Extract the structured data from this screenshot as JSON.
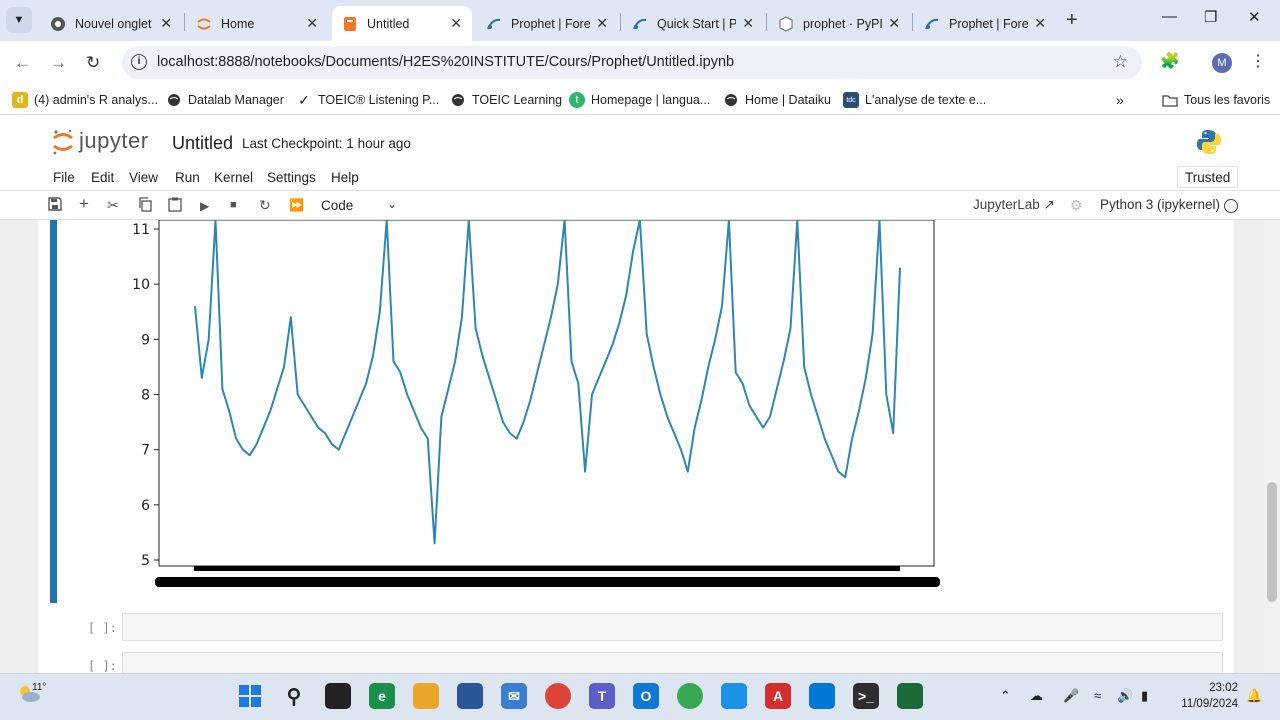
{
  "browser": {
    "tabs": [
      {
        "label": "Nouvel onglet",
        "icon": "chrome-icon"
      },
      {
        "label": "Home",
        "icon": "jupyter-icon"
      },
      {
        "label": "Untitled",
        "icon": "notebook-icon",
        "active": true
      },
      {
        "label": "Prophet | Fore",
        "icon": "prophet-icon"
      },
      {
        "label": "Quick Start | P",
        "icon": "prophet-icon"
      },
      {
        "label": "prophet · PyPI",
        "icon": "pypi-icon"
      },
      {
        "label": "Prophet | Fore",
        "icon": "prophet-icon"
      }
    ],
    "url": "localhost:8888/notebooks/Documents/H2ES%20INSTITUTE/Cours/Prophet/Untitled.ipynb",
    "profile_initial": "M",
    "bookmarks": [
      {
        "label": "(4) admin's R analys...",
        "icon": "d-icon",
        "icon_text": "d"
      },
      {
        "label": "Datalab Manager",
        "icon": "globe-icon"
      },
      {
        "label": "TOEIC® Listening P...",
        "icon": "check-icon"
      },
      {
        "label": "TOEIC Learning",
        "icon": "globe-icon"
      },
      {
        "label": "Homepage | langua...",
        "icon": "t-icon",
        "icon_text": "t"
      },
      {
        "label": "Home | Dataiku",
        "icon": "globe-icon"
      },
      {
        "label": "L'analyse de texte e...",
        "icon": "tdc-icon",
        "icon_text": "tdc"
      }
    ],
    "all_bookmarks": "Tous les favoris"
  },
  "jupyter": {
    "logo_text": "jupyter",
    "notebook_title": "Untitled",
    "checkpoint": "Last Checkpoint: 1 hour ago",
    "menu": [
      "File",
      "Edit",
      "View",
      "Run",
      "Kernel",
      "Settings",
      "Help"
    ],
    "trusted": "Trusted",
    "cell_type": "Code",
    "jupyterlab_link": "JupyterLab",
    "kernel": "Python 3 (ipykernel)",
    "empty_prompts": [
      "[ ]:",
      "[ ]:"
    ]
  },
  "chart_data": {
    "type": "line",
    "title": "",
    "xlabel": "",
    "ylabel": "",
    "yticks": [
      5,
      6,
      7,
      8,
      9,
      10,
      11
    ],
    "ylim": [
      4.9,
      11.3
    ],
    "line_color": "#2e86b5",
    "grid": false,
    "approx_cycles": 7,
    "series": [
      {
        "values": [
          9.6,
          8.3,
          9.0,
          11.2,
          8.1,
          7.7,
          7.2,
          7.0,
          6.9,
          7.1,
          7.4,
          7.7,
          8.1,
          8.5,
          9.4,
          8.0,
          7.8,
          7.6,
          7.4,
          7.3,
          7.1,
          7.0,
          7.3,
          7.6,
          7.9,
          8.2,
          8.7,
          9.5,
          11.2,
          8.6,
          8.4,
          8.0,
          7.7,
          7.4,
          7.2,
          5.3,
          7.6,
          8.1,
          8.6,
          9.4,
          11.2,
          9.2,
          8.7,
          8.3,
          7.9,
          7.5,
          7.3,
          7.2,
          7.5,
          7.9,
          8.4,
          8.9,
          9.4,
          10.0,
          11.2,
          8.6,
          8.2,
          6.6,
          8.0,
          8.3,
          8.6,
          8.9,
          9.3,
          9.8,
          10.6,
          11.2,
          9.1,
          8.5,
          8.0,
          7.6,
          7.3,
          7.0,
          6.6,
          7.4,
          7.9,
          8.5,
          9.0,
          9.6,
          11.2,
          8.4,
          8.2,
          7.8,
          7.6,
          7.4,
          7.6,
          8.1,
          8.6,
          9.2,
          11.2,
          8.5,
          8.0,
          7.6,
          7.2,
          6.9,
          6.6,
          6.5,
          7.2,
          7.7,
          8.3,
          9.1,
          11.2,
          8.0,
          7.3,
          10.3
        ]
      }
    ]
  },
  "taskbar": {
    "temperature": "11°",
    "time": "23:02",
    "date": "11/09/2024"
  }
}
